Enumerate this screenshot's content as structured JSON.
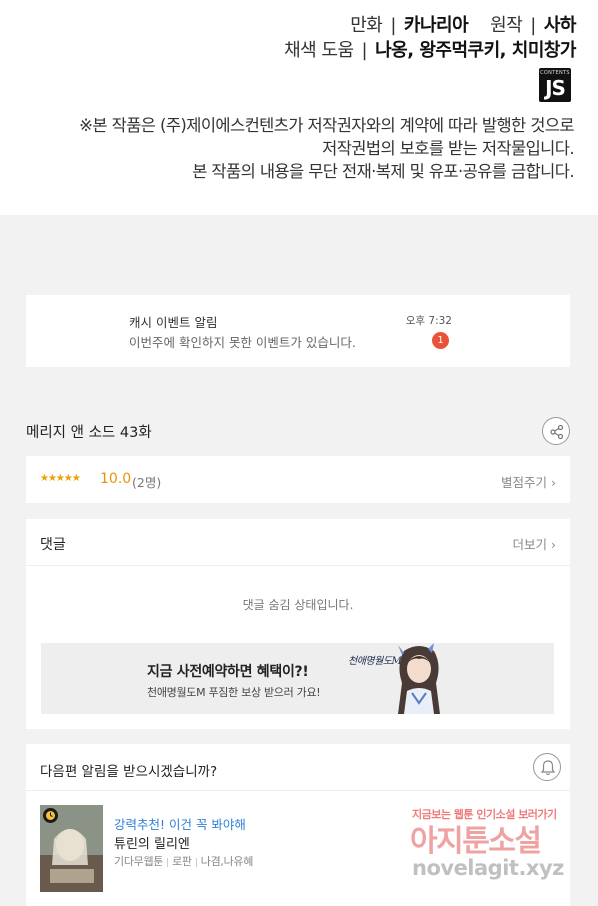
{
  "credits": {
    "line1": {
      "label1": "만화",
      "value1": "카나리아",
      "label2": "원작",
      "value2": "사하"
    },
    "line2": {
      "label": "채색 도움",
      "value": "나옹, 왕주먹쿠키, 치미창가"
    },
    "logo": {
      "small": "CONTENTS",
      "big": "JS"
    },
    "notice": [
      "※본 작품은 (주)제이에스컨텐츠가 저작권자와의 계약에 따라 발행한 것으로",
      "저작권법의 보호를 받는 저작물입니다.",
      "본 작품의 내용을 무단 전재·복제 및 유포·공유를 금합니다."
    ]
  },
  "alarm": {
    "title": "캐시 이벤트 알림",
    "message": "이번주에 확인하지 못한 이벤트가 있습니다.",
    "time": "오후 7:32",
    "badge": "1"
  },
  "episode": {
    "title": "메리지 앤 소드 43화",
    "share_icon": "share-icon"
  },
  "rating": {
    "stars": "★★★★★",
    "score": "10.0",
    "count": "(2명)",
    "rate_button": "별점주기"
  },
  "comments": {
    "header": "댓글",
    "more_button": "더보기",
    "hidden_message": "댓글 숨김 상태입니다.",
    "banner": {
      "title": "지금 사전예약하면 혜택이?!",
      "subtitle": "천애명월도M 푸짐한 보상 받으러 가요!",
      "logo": "천애명월도M"
    }
  },
  "next": {
    "question": "다음편 알림을 받으시겠습니까?",
    "bell_icon": "bell-icon",
    "recommend_label": "강력추천! 이건 꼭 봐야해",
    "title": "튜린의 릴리엔",
    "meta": {
      "badge": "기다무웹툰",
      "genre": "로판",
      "authors": "나겸,나유혜"
    }
  },
  "watermark": {
    "small": "지금보는 웹툰 인기소설 보러가기",
    "big": "아지툰소설",
    "url": "novelagit.xyz"
  },
  "colors": {
    "accent_orange": "#e8940a",
    "badge_red": "#e8523a",
    "link_blue": "#2f7fd8"
  }
}
